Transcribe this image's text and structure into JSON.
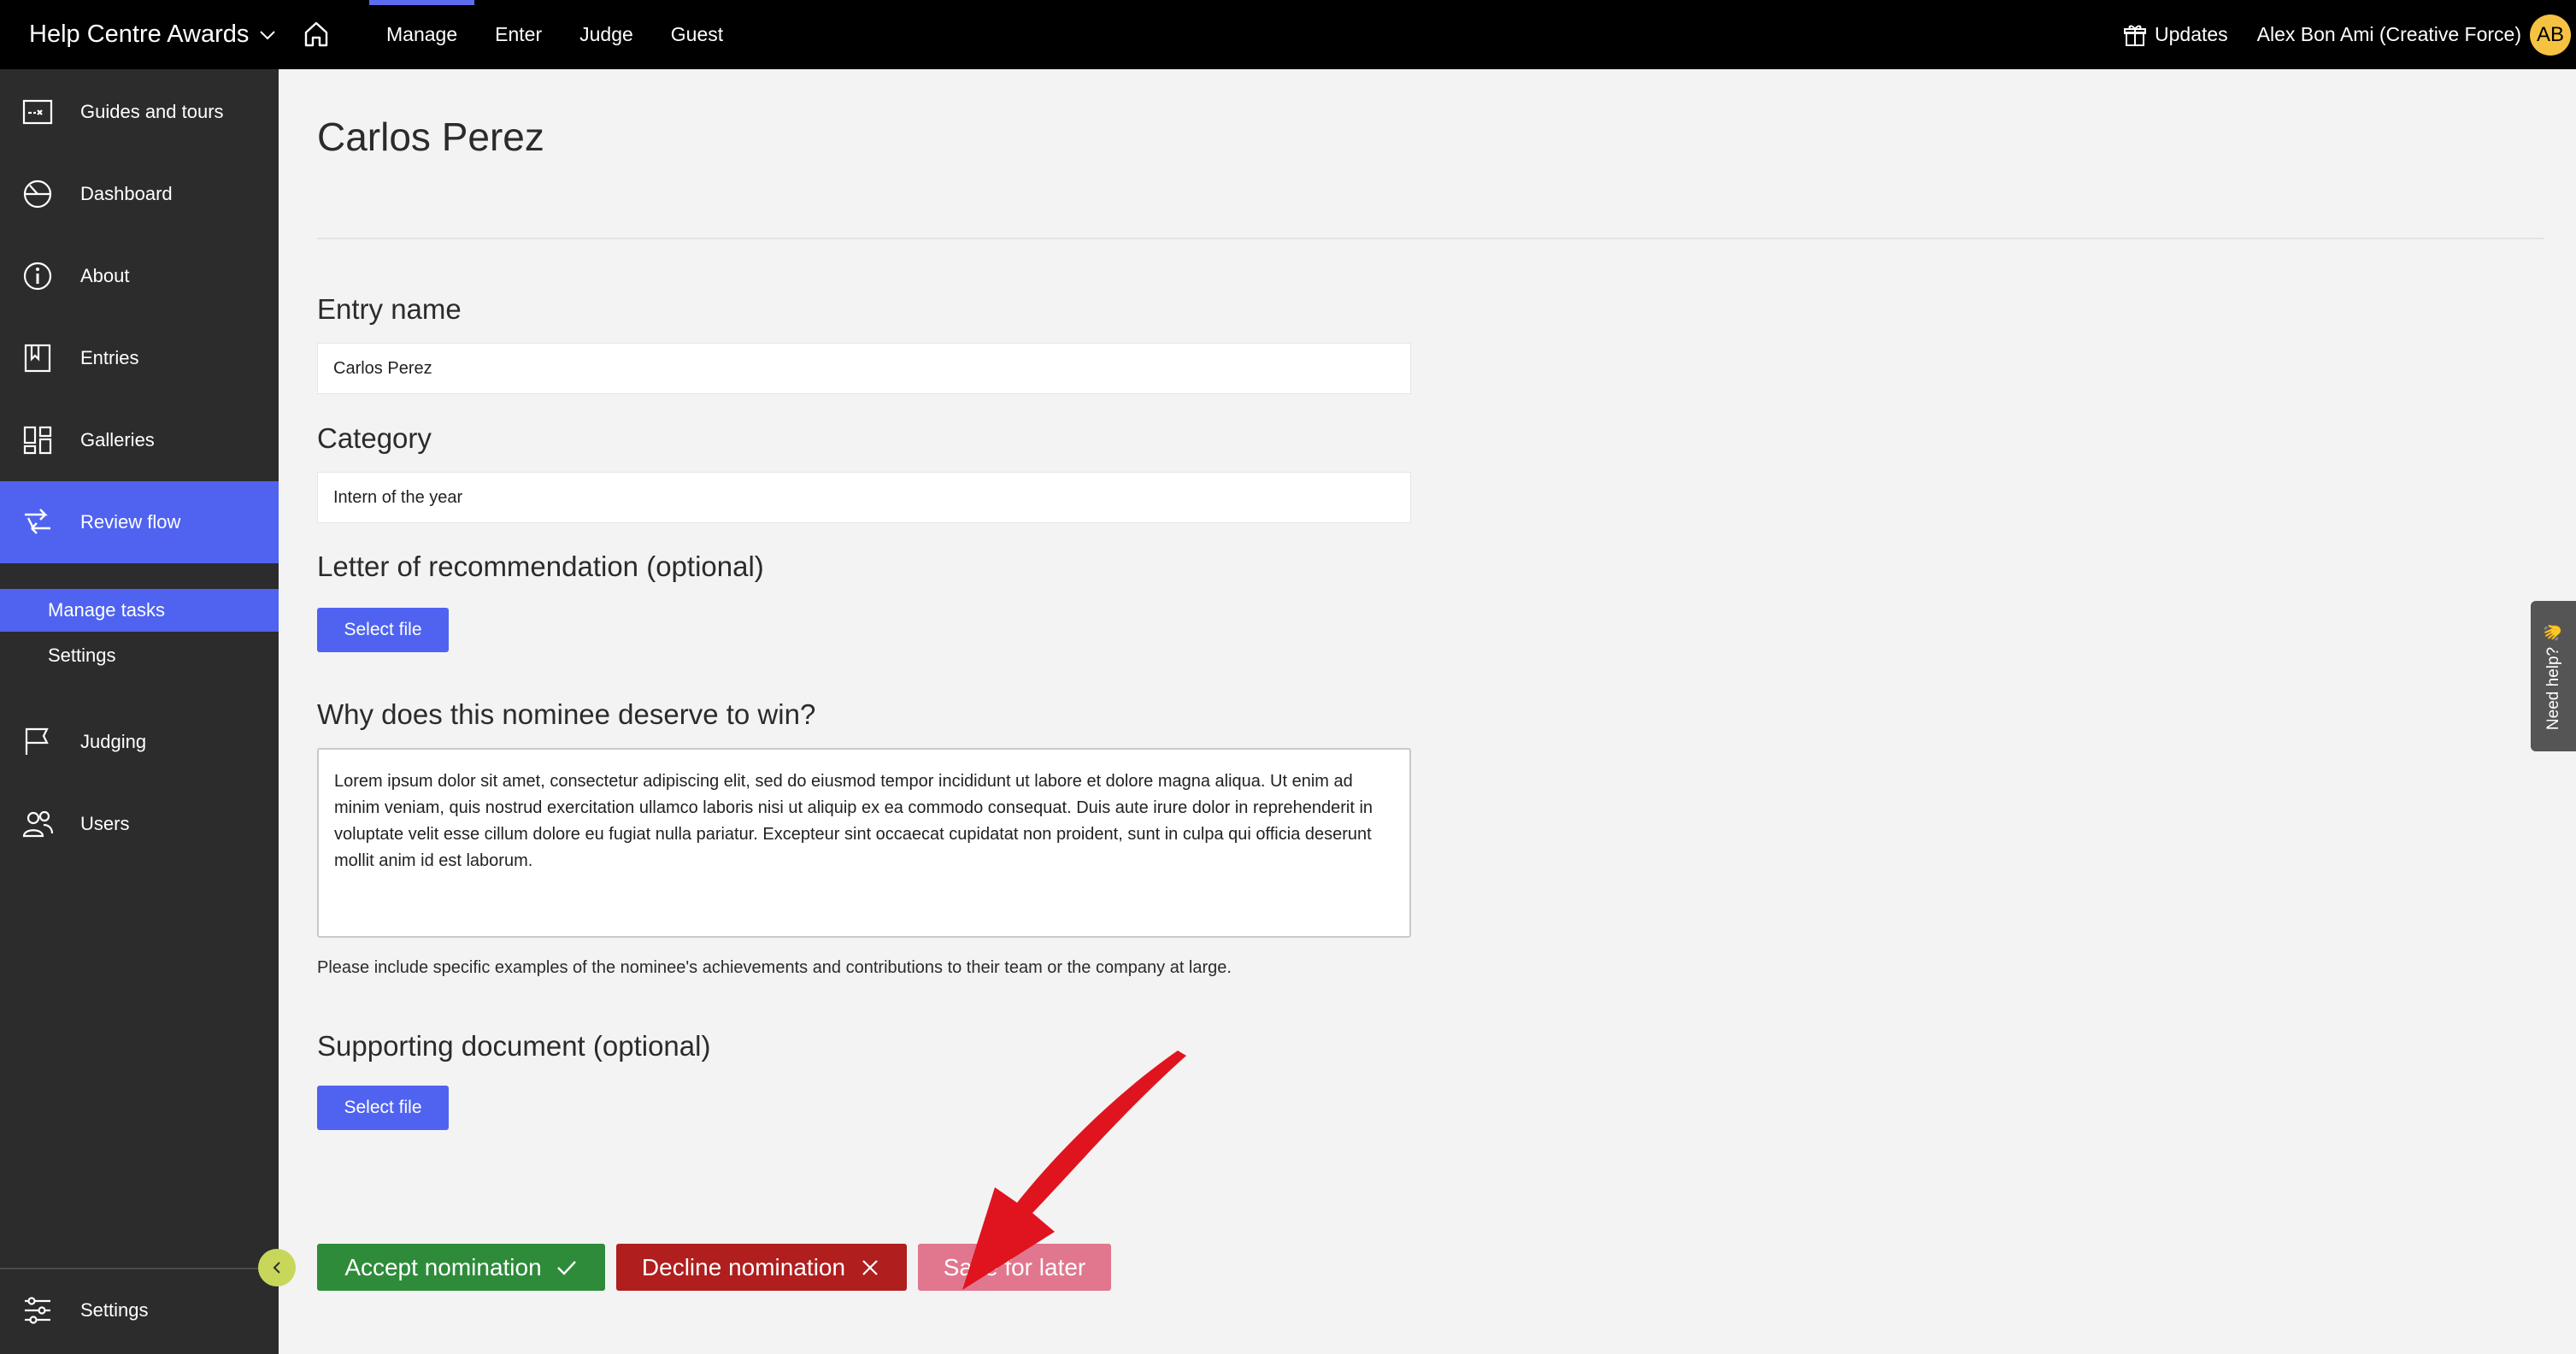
{
  "topbar": {
    "brand": "Help Centre Awards",
    "nav": [
      "Manage",
      "Enter",
      "Judge",
      "Guest"
    ],
    "updates_label": "Updates",
    "user_name": "Alex Bon Ami (Creative Force)",
    "avatar_initials": "AB"
  },
  "sidebar": {
    "items": [
      {
        "label": "Guides and tours",
        "icon": "map-icon"
      },
      {
        "label": "Dashboard",
        "icon": "dashboard-gauge-icon"
      },
      {
        "label": "About",
        "icon": "info-icon"
      },
      {
        "label": "Entries",
        "icon": "bookmark-icon"
      },
      {
        "label": "Galleries",
        "icon": "grid-icon"
      },
      {
        "label": "Review flow",
        "icon": "review-flow-icon"
      },
      {
        "label": "Judging",
        "icon": "flag-icon"
      },
      {
        "label": "Users",
        "icon": "users-icon"
      }
    ],
    "sub_items": [
      "Manage tasks",
      "Settings"
    ],
    "bottom_item": {
      "label": "Settings",
      "icon": "sliders-icon"
    }
  },
  "main": {
    "title": "Carlos Perez",
    "entry_name_label": "Entry name",
    "entry_name_value": "Carlos Perez",
    "category_label": "Category",
    "category_value": "Intern of the year",
    "letter_label": "Letter of recommendation (optional)",
    "select_file": "Select file",
    "why_label": "Why does this nominee deserve to win?",
    "why_text": "Lorem ipsum dolor sit amet, consectetur adipiscing elit, sed do eiusmod tempor incididunt ut labore et dolore magna aliqua. Ut enim ad minim veniam, quis nostrud exercitation ullamco laboris nisi ut aliquip ex ea commodo consequat. Duis aute irure dolor in reprehenderit in voluptate velit esse cillum dolore eu fugiat nulla pariatur. Excepteur sint occaecat cupidatat non proident, sunt in culpa qui officia deserunt mollit anim id est laborum.",
    "why_help": "Please include specific examples of the nominee's achievements and contributions to their team or the company at large.",
    "supporting_label": "Supporting document (optional)",
    "accept_label": "Accept nomination",
    "decline_label": "Decline nomination",
    "later_label": "Save for later"
  },
  "need_help": "Need help? 👋",
  "colors": {
    "accent": "#4f63f0",
    "accept": "#2e8b3a",
    "decline": "#b01e1e",
    "save_later": "#e0778f",
    "sidebar_bg": "#2c2c2c",
    "annotation_arrow": "#e0141e"
  }
}
